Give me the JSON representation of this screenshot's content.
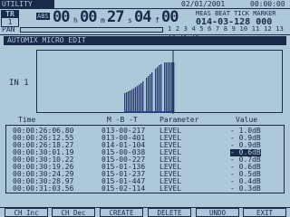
{
  "top": {
    "title": "UTILITY",
    "date": "02/01/2001",
    "clock": "00:00:00"
  },
  "track": {
    "label": "TR",
    "number": "1"
  },
  "timecode": {
    "badge": "ABS",
    "h": "00",
    "h_unit": "h",
    "m": "00",
    "m_unit": "m",
    "s": "27",
    "s_unit": "s",
    "f": "04",
    "f_unit": "f",
    "sub": "00"
  },
  "position": {
    "header": "MEAS BEAT TICK MARKER",
    "value": "014-03-128 000"
  },
  "pan": {
    "label": "PAN",
    "channels": "1 2 3 4 5 6 7 8 9 10 11 12 13 14 15 16"
  },
  "window": {
    "title": "AUTOMIX MICRO EDIT",
    "input_label": "IN  1"
  },
  "table": {
    "headers": {
      "time": "Time",
      "mbt": "M -B -T",
      "parameter": "Parameter",
      "value": "Value"
    },
    "rows": [
      {
        "time": "00:00:26:06.80",
        "mbt": "013-00-217",
        "param": "LEVEL",
        "value": "- 1.0dB"
      },
      {
        "time": "00:00:26:12.55",
        "mbt": "013-00-401",
        "param": "LEVEL",
        "value": "- 0.9dB"
      },
      {
        "time": "00:00:26:18.27",
        "mbt": "014-01-104",
        "param": "LEVEL",
        "value": "- 0.9dB"
      },
      {
        "time": "00:00:30:01.19",
        "mbt": "015-00-038",
        "param": "LEVEL",
        "value": "- 0.6dB",
        "selected": true
      },
      {
        "time": "00:00:30:10.22",
        "mbt": "015-00-227",
        "param": "LEVEL",
        "value": "- 0.7dB"
      },
      {
        "time": "00:00:30:19.26",
        "mbt": "015-01-136",
        "param": "LEVEL",
        "value": "- 0.6dB"
      },
      {
        "time": "00:00:30:24.29",
        "mbt": "015-01-237",
        "param": "LEVEL",
        "value": "- 0.5dB"
      },
      {
        "time": "00:00:30:28.97",
        "mbt": "015-01-447",
        "param": "LEVEL",
        "value": "- 0.4dB"
      },
      {
        "time": "00:00:31:03.56",
        "mbt": "015-02-114",
        "param": "LEVEL",
        "value": "- 0.3dB"
      }
    ]
  },
  "buttons": {
    "ch_inc": "CH Inc",
    "ch_dec": "CH Dec",
    "create": "CREATE",
    "delete": "DELETE",
    "undo": "UNDO",
    "exit": "EXIT"
  },
  "colors": {
    "ink": "#1a2a4a",
    "lcd": "#adc8d8",
    "wave": "#2d3f8c"
  }
}
